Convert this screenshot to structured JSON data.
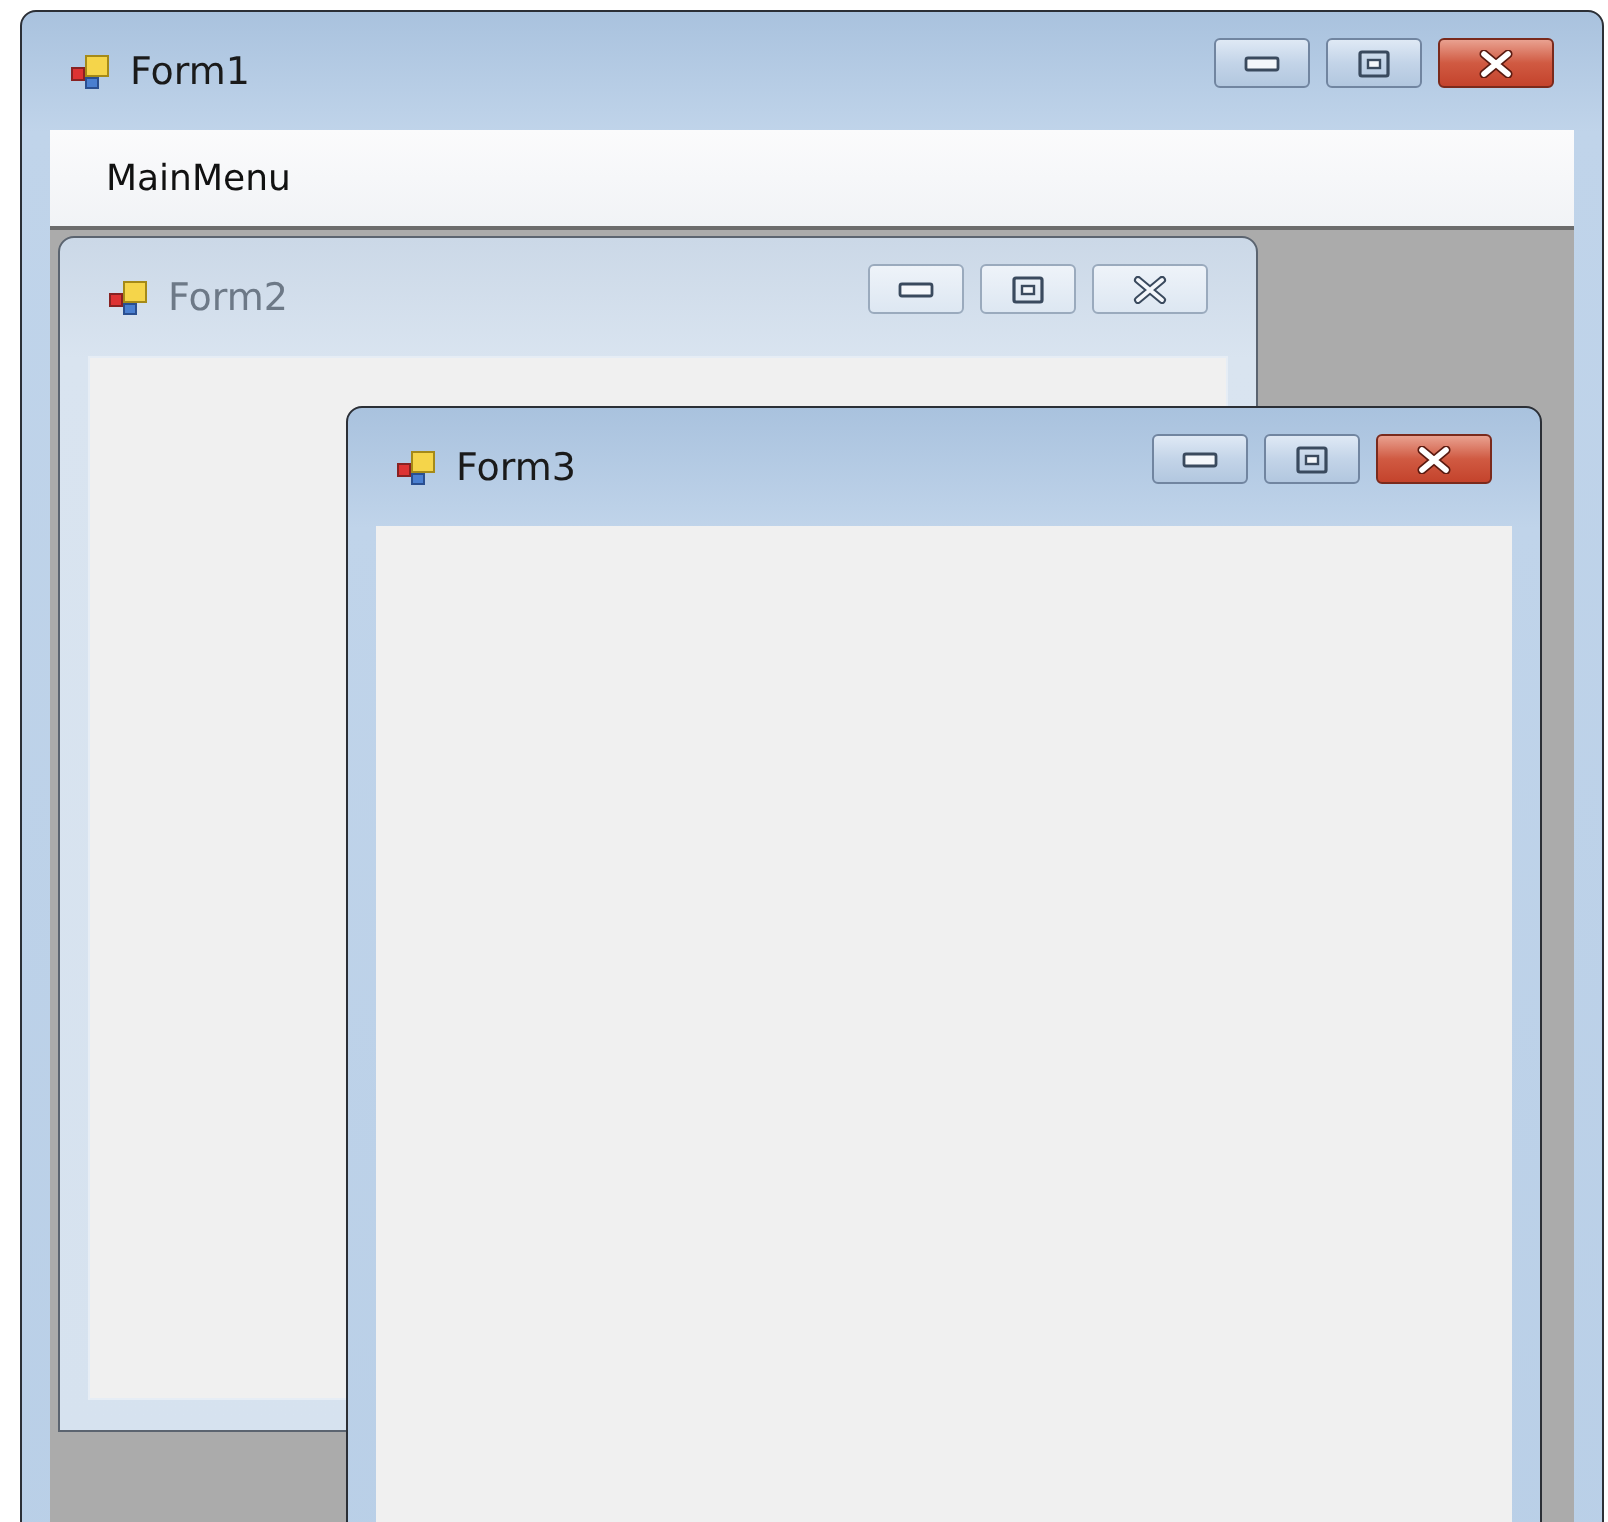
{
  "window": {
    "title": "Form1",
    "active": true
  },
  "menu": [
    {
      "label": "MainMenu"
    }
  ],
  "mdi_children": [
    {
      "title": "Form2",
      "active": false
    },
    {
      "title": "Form3",
      "active": true
    }
  ]
}
